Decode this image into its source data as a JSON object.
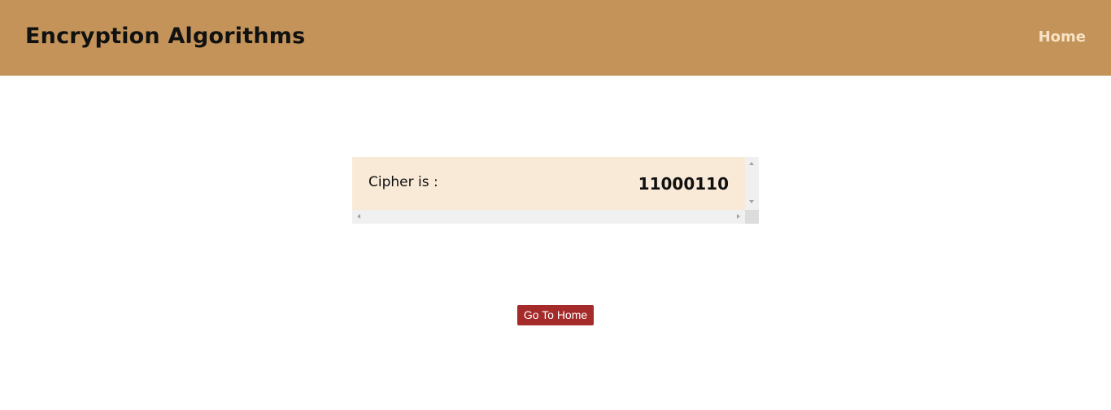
{
  "header": {
    "title": "Encryption Algorithms",
    "nav_home_label": "Home",
    "background_color": "#c39359",
    "nav_link_color": "#f7e2c6"
  },
  "result": {
    "label": "Cipher is :",
    "value": "11000110",
    "background_color": "#f9ead7"
  },
  "scrollbars": {
    "up_icon": "triangle-up-icon",
    "down_icon": "triangle-down-icon",
    "left_icon": "triangle-left-icon",
    "right_icon": "triangle-right-icon"
  },
  "actions": {
    "go_home_label": "Go To Home",
    "button_color": "#a52a2a"
  }
}
